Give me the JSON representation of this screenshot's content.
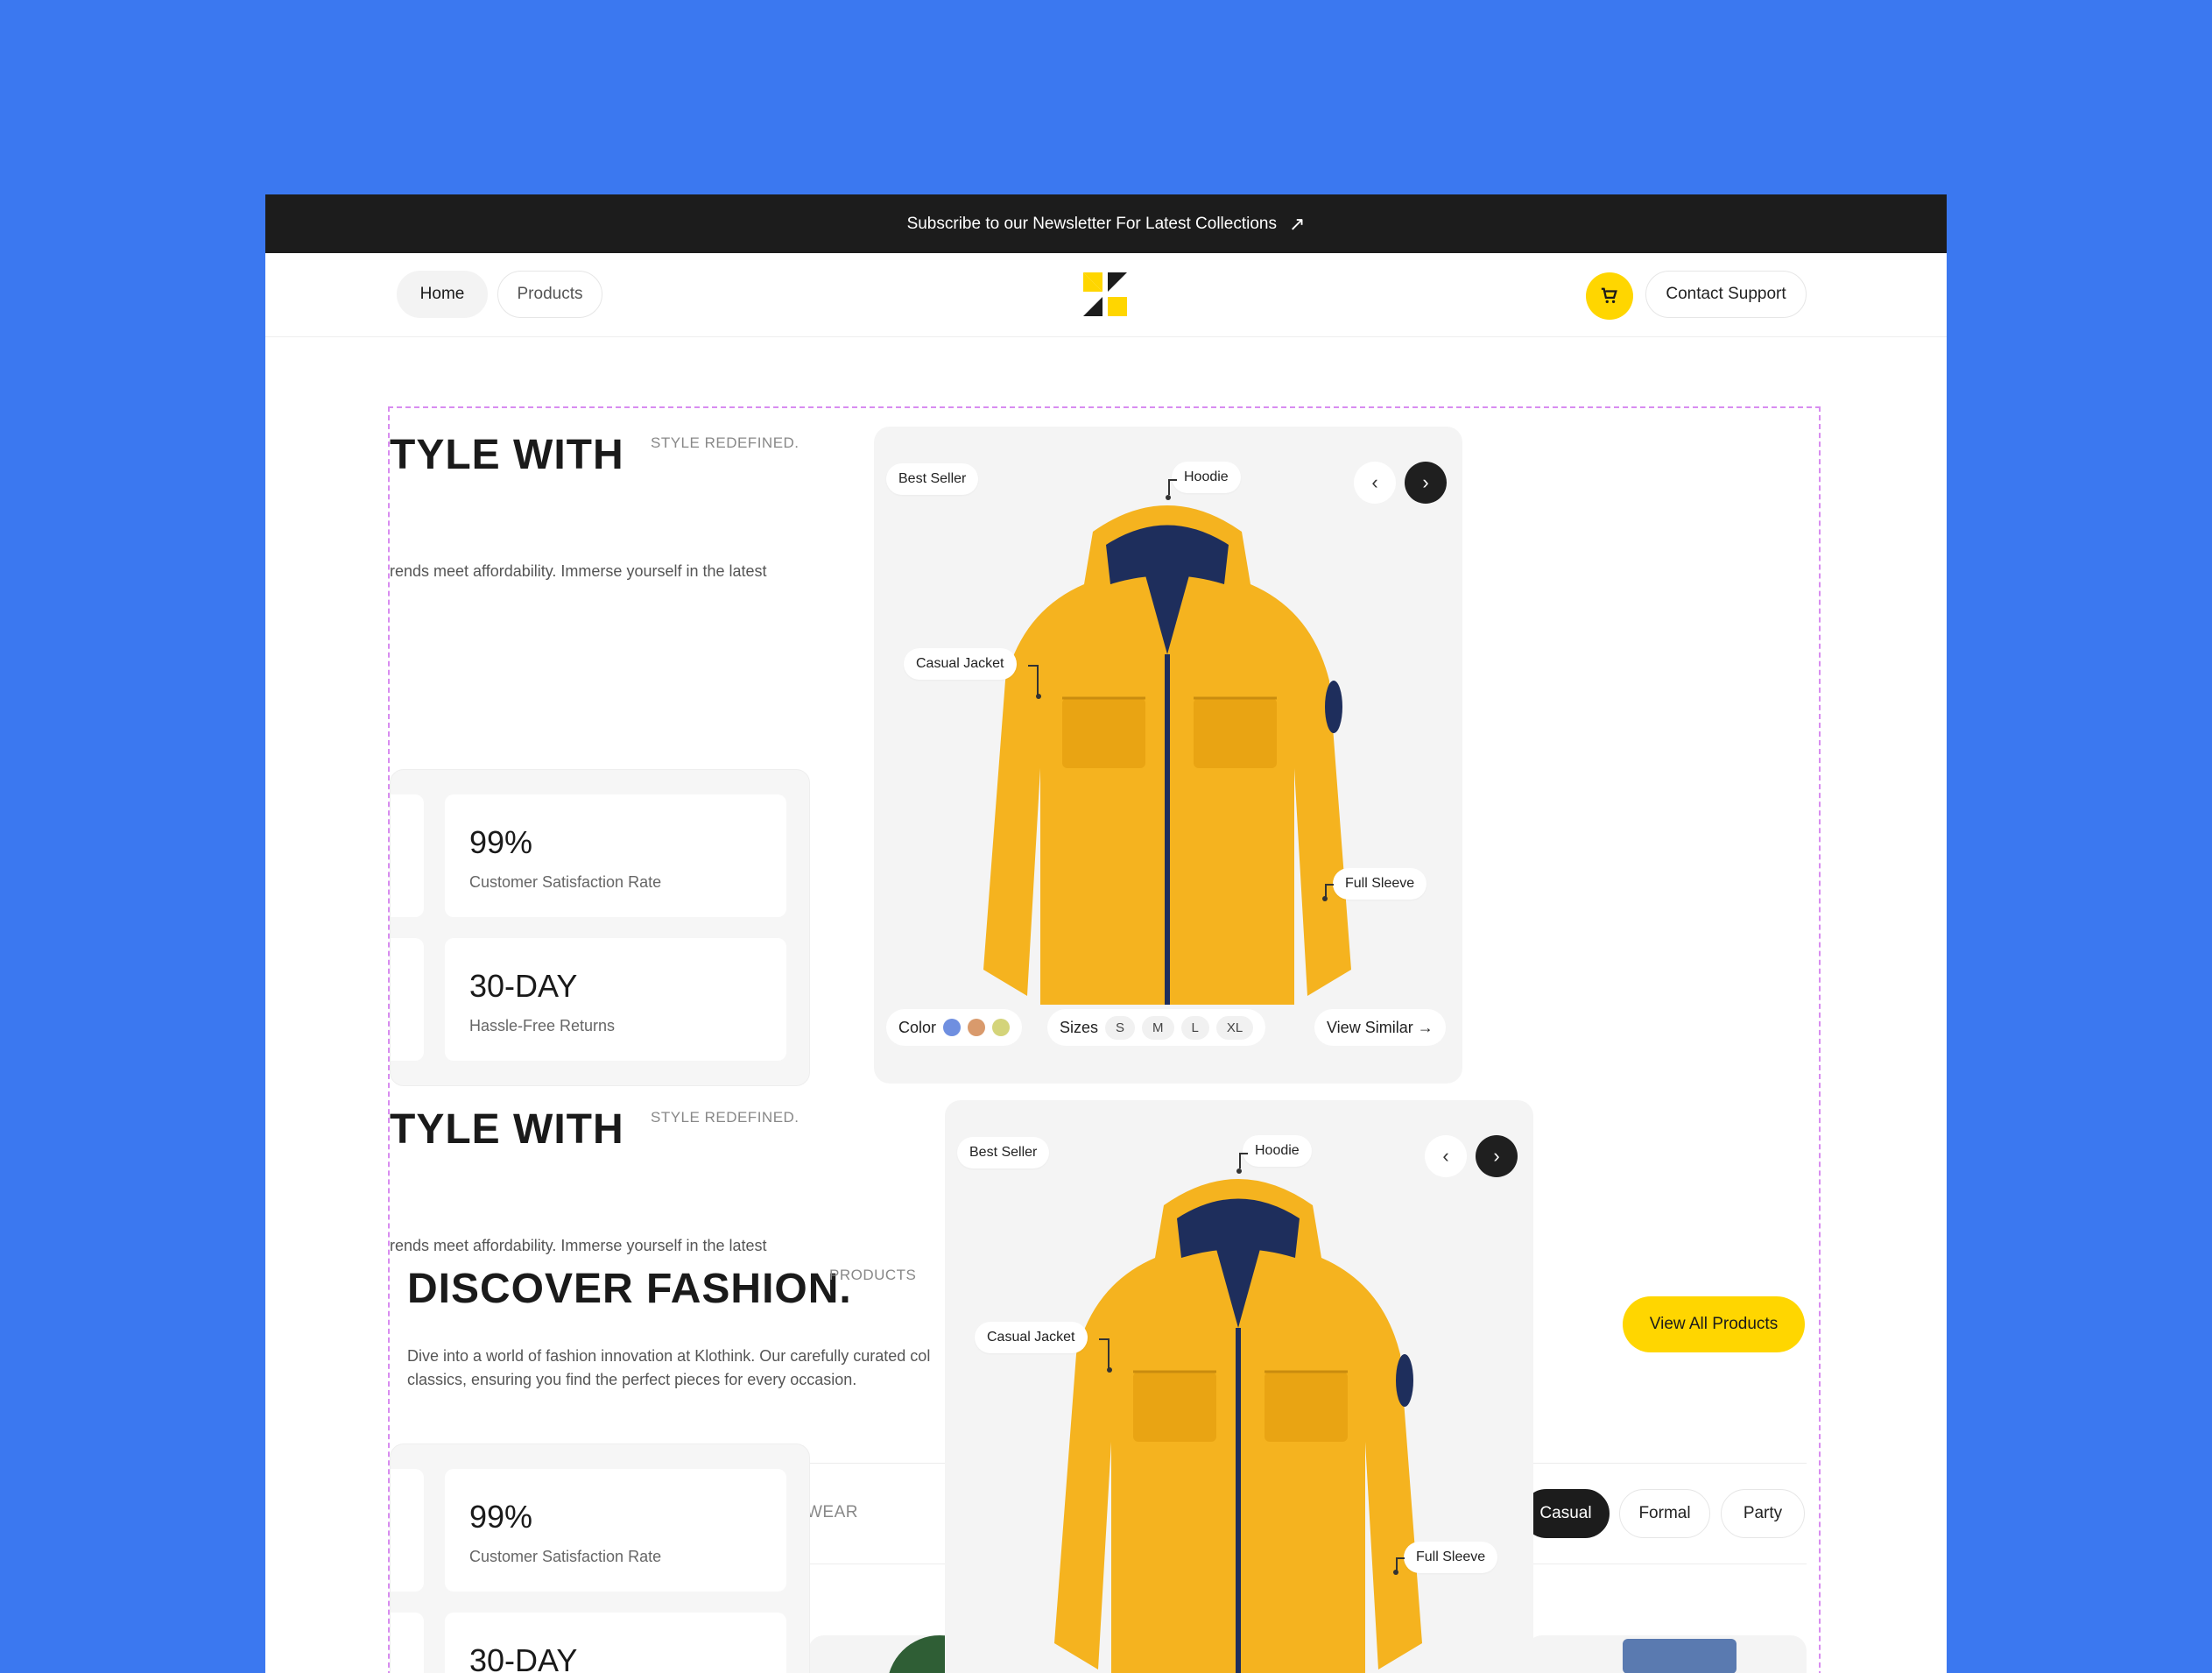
{
  "topbar": {
    "text": "Subscribe to our Newsletter For Latest Collections",
    "arrow": "↗"
  },
  "nav": {
    "home": "Home",
    "products": "Products",
    "contact": "Contact Support",
    "cart_icon": "cart-icon"
  },
  "colors": {
    "background": "#3b78f0",
    "accent": "#ffd600",
    "dark": "#1c1c1c",
    "jacket": "#f5b31f"
  },
  "hero": {
    "title": "TYLE WITH",
    "eyebrow": "STYLE REDEFINED.",
    "paragraph": "rends meet affordability. Immerse yourself in the latest"
  },
  "stats": [
    {
      "value": "99%",
      "label": "Customer Satisfaction Rate"
    },
    {
      "value": "30-DAY",
      "label": "Hassle-Free Returns"
    }
  ],
  "product": {
    "badge": "Best Seller",
    "tag_hoodie": "Hoodie",
    "tag_casual": "Casual Jacket",
    "tag_sleeve": "Full Sleeve",
    "prev": "‹",
    "next": "›",
    "color_label": "Color",
    "swatches": [
      "#6f8fe0",
      "#d99a6c",
      "#d4d47a"
    ],
    "sizes_label": "Sizes",
    "sizes": [
      "S",
      "M",
      "L",
      "XL"
    ],
    "view_similar": "View Similar →"
  },
  "discover": {
    "title": "DISCOVER FASHION.",
    "eyebrow": "PRODUCTS",
    "line1": "Dive into a world of fashion innovation at Klothink. Our carefully curated col",
    "line2": "classics, ensuring you find the perfect pieces for every occasion.",
    "cta": "View All Products"
  },
  "filters": {
    "partial": "WEAR",
    "casual": "Casual",
    "formal": "Formal",
    "party": "Party"
  }
}
